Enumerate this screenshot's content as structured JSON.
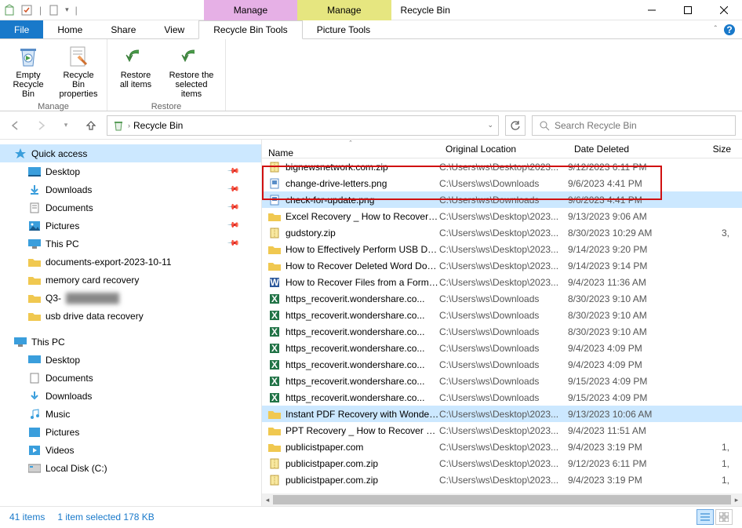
{
  "window": {
    "title": "Recycle Bin",
    "ctx_tab1": "Manage",
    "ctx_tab2": "Manage"
  },
  "tabs": {
    "file": "File",
    "home": "Home",
    "share": "Share",
    "view": "View",
    "rbt": "Recycle Bin Tools",
    "pt": "Picture Tools"
  },
  "ribbon": {
    "empty": "Empty Recycle Bin",
    "props": "Recycle Bin properties",
    "restore_all": "Restore all items",
    "restore_sel": "Restore the selected items",
    "group_manage": "Manage",
    "group_restore": "Restore"
  },
  "breadcrumb": {
    "location": "Recycle Bin"
  },
  "search": {
    "placeholder": "Search Recycle Bin"
  },
  "columns": {
    "name": "Name",
    "loc": "Original Location",
    "date": "Date Deleted",
    "size": "Size"
  },
  "nav": {
    "quick": "Quick access",
    "desktop": "Desktop",
    "downloads": "Downloads",
    "documents": "Documents",
    "pictures": "Pictures",
    "thispc": "This PC",
    "folder1": "documents-export-2023-10-11",
    "folder2": "memory card recovery",
    "folder3": "Q3-",
    "folder4": "usb drive data recovery",
    "thispc2": "This PC",
    "desktop2": "Desktop",
    "documents2": "Documents",
    "downloads2": "Downloads",
    "music": "Music",
    "pictures2": "Pictures",
    "videos": "Videos",
    "localdisk": "Local Disk (C:)"
  },
  "files": [
    {
      "icon": "zip",
      "name": "bignewsnetwork.com.zip",
      "loc": "C:\\Users\\ws\\Desktop\\2023...",
      "date": "9/12/2023 6:11 PM",
      "size": ""
    },
    {
      "icon": "png",
      "name": "change-drive-letters.png",
      "loc": "C:\\Users\\ws\\Downloads",
      "date": "9/6/2023 4:41 PM",
      "size": ""
    },
    {
      "icon": "png",
      "name": "check-for-update.png",
      "loc": "C:\\Users\\ws\\Downloads",
      "date": "9/6/2023 4:41 PM",
      "size": "",
      "selected": true
    },
    {
      "icon": "folder",
      "name": "Excel Recovery _ How to Recover U...",
      "loc": "C:\\Users\\ws\\Desktop\\2023...",
      "date": "9/13/2023 9:06 AM",
      "size": ""
    },
    {
      "icon": "zip",
      "name": "gudstory.zip",
      "loc": "C:\\Users\\ws\\Desktop\\2023...",
      "date": "8/30/2023 10:29 AM",
      "size": "3,"
    },
    {
      "icon": "folder",
      "name": "How to Effectively Perform USB Da...",
      "loc": "C:\\Users\\ws\\Desktop\\2023...",
      "date": "9/14/2023 9:20 PM",
      "size": ""
    },
    {
      "icon": "folder",
      "name": "How to Recover Deleted Word Doc...",
      "loc": "C:\\Users\\ws\\Desktop\\2023...",
      "date": "9/14/2023 9:14 PM",
      "size": ""
    },
    {
      "icon": "word",
      "name": "How to Recover Files from a Forma...",
      "loc": "C:\\Users\\ws\\Desktop\\2023...",
      "date": "9/4/2023 11:36 AM",
      "size": ""
    },
    {
      "icon": "excel",
      "name": "https_recoverit.wondershare.co...",
      "loc": "C:\\Users\\ws\\Downloads",
      "date": "8/30/2023 9:10 AM",
      "size": ""
    },
    {
      "icon": "excel",
      "name": "https_recoverit.wondershare.co...",
      "loc": "C:\\Users\\ws\\Downloads",
      "date": "8/30/2023 9:10 AM",
      "size": ""
    },
    {
      "icon": "excel",
      "name": "https_recoverit.wondershare.co...",
      "loc": "C:\\Users\\ws\\Downloads",
      "date": "8/30/2023 9:10 AM",
      "size": ""
    },
    {
      "icon": "excel",
      "name": "https_recoverit.wondershare.co...",
      "loc": "C:\\Users\\ws\\Downloads",
      "date": "9/4/2023 4:09 PM",
      "size": ""
    },
    {
      "icon": "excel",
      "name": "https_recoverit.wondershare.co...",
      "loc": "C:\\Users\\ws\\Downloads",
      "date": "9/4/2023 4:09 PM",
      "size": ""
    },
    {
      "icon": "excel",
      "name": "https_recoverit.wondershare.co...",
      "loc": "C:\\Users\\ws\\Downloads",
      "date": "9/15/2023 4:09 PM",
      "size": ""
    },
    {
      "icon": "excel",
      "name": "https_recoverit.wondershare.co...",
      "loc": "C:\\Users\\ws\\Downloads",
      "date": "9/15/2023 4:09 PM",
      "size": ""
    },
    {
      "icon": "folder",
      "name": "Instant PDF Recovery with Wonder...",
      "loc": "C:\\Users\\ws\\Desktop\\2023...",
      "date": "9/13/2023 10:06 AM",
      "size": "",
      "hl": true
    },
    {
      "icon": "folder",
      "name": "PPT Recovery _ How to Recover Un...",
      "loc": "C:\\Users\\ws\\Desktop\\2023...",
      "date": "9/4/2023 11:51 AM",
      "size": ""
    },
    {
      "icon": "folder",
      "name": "publicistpaper.com",
      "loc": "C:\\Users\\ws\\Desktop\\2023...",
      "date": "9/4/2023 3:19 PM",
      "size": "1,"
    },
    {
      "icon": "zip",
      "name": "publicistpaper.com.zip",
      "loc": "C:\\Users\\ws\\Desktop\\2023...",
      "date": "9/12/2023 6:11 PM",
      "size": "1,"
    },
    {
      "icon": "zip",
      "name": "publicistpaper.com.zip",
      "loc": "C:\\Users\\ws\\Desktop\\2023...",
      "date": "9/4/2023 3:19 PM",
      "size": "1,"
    }
  ],
  "status": {
    "count": "41 items",
    "selection": "1 item selected  178 KB"
  }
}
